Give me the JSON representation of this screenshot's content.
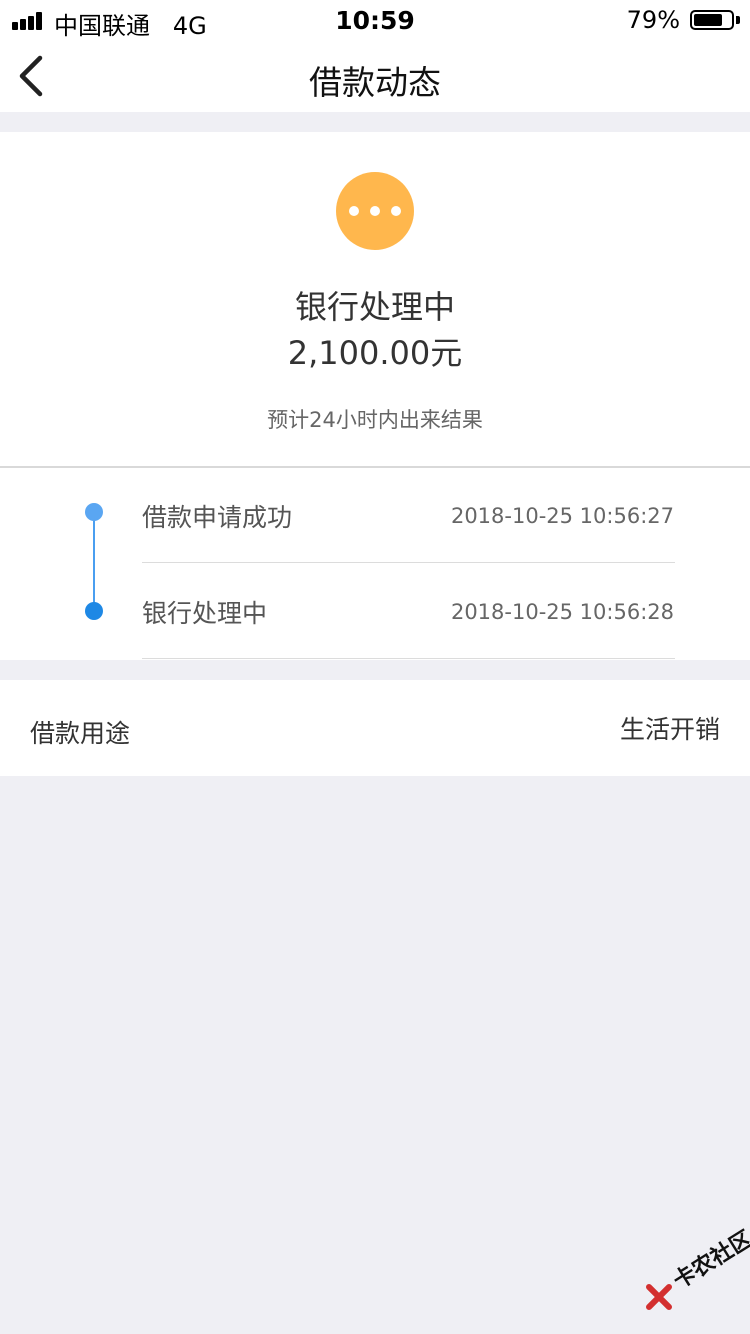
{
  "status_bar": {
    "carrier": "中国联通   4G",
    "time": "10:59",
    "battery_percent": "79%",
    "battery_level": 0.79
  },
  "nav": {
    "title": "借款动态",
    "back_icon": "chevron-left-icon"
  },
  "status": {
    "icon": "more-dots-icon",
    "icon_color": "#ffb74d",
    "title": "银行处理中",
    "amount": "2,100.00元",
    "note": "预计24小时内出来结果"
  },
  "timeline": [
    {
      "label": "借款申请成功",
      "time": "2018-10-25 10:56:27"
    },
    {
      "label": "银行处理中",
      "time": "2018-10-25 10:56:28"
    }
  ],
  "timeline_color": "#1e88e5",
  "purpose": {
    "label": "借款用途",
    "value": "生活开销"
  },
  "watermark": {
    "text": "卡农社区",
    "icon": "red-x-logo-icon"
  }
}
